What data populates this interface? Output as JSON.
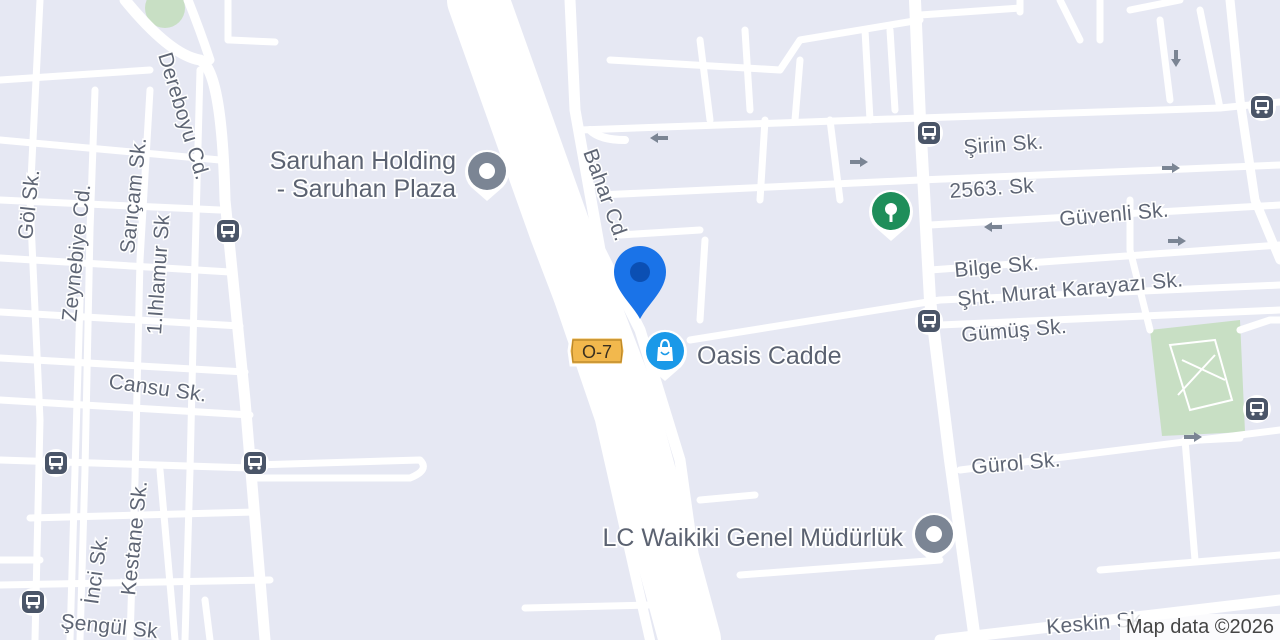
{
  "map": {
    "colors": {
      "land": "#e6e8f3",
      "road": "#ffffff",
      "park": "#c8dfc4",
      "label": "#5f6675",
      "poi_gray": "#7b8594",
      "poi_green": "#1e8e5a",
      "poi_blue": "#1a99e8",
      "selected_pin": "#1a73e8",
      "shield": "#f2b84d"
    },
    "streets": {
      "dereboyu": "Dereboyu Cd.",
      "saricam": "Sarıçam Sk.",
      "gol": "Göl Sk.",
      "zeynebiye": "Zeynebiye Cd.",
      "ihlamur": "1.Ihlamur Sk",
      "cansu": "Cansu Sk.",
      "inci": "İnci Sk.",
      "kestane": "Kestane Sk.",
      "sengul": "Şengül Sk",
      "bahar": "Bahar Cd.",
      "sirin": "Şirin Sk.",
      "s2563": "2563. Sk",
      "guvenli": "Güvenli Sk.",
      "bilge": "Bilge Sk.",
      "murat": "Şht. Murat Karayazı Sk.",
      "gumus": "Gümüş Sk.",
      "gurol": "Gürol Sk.",
      "keskin": "Keskin Sk"
    },
    "highway_shield": "O-7",
    "pois": {
      "saruhan_line1": "Saruhan Holding",
      "saruhan_line2": "- Saruhan Plaza",
      "oasis": "Oasis Cadde",
      "lcw": "LC Waikiki Genel Müdürlük"
    },
    "icons": {
      "bus_stop": "bus-stop-icon",
      "selected_location": "location-pin-icon",
      "shopping": "shopping-bag-icon",
      "generic_place": "place-marker-icon",
      "park": "park-marker-icon",
      "one_way": "one-way-arrow-icon"
    },
    "attribution": "Map data ©2026"
  }
}
